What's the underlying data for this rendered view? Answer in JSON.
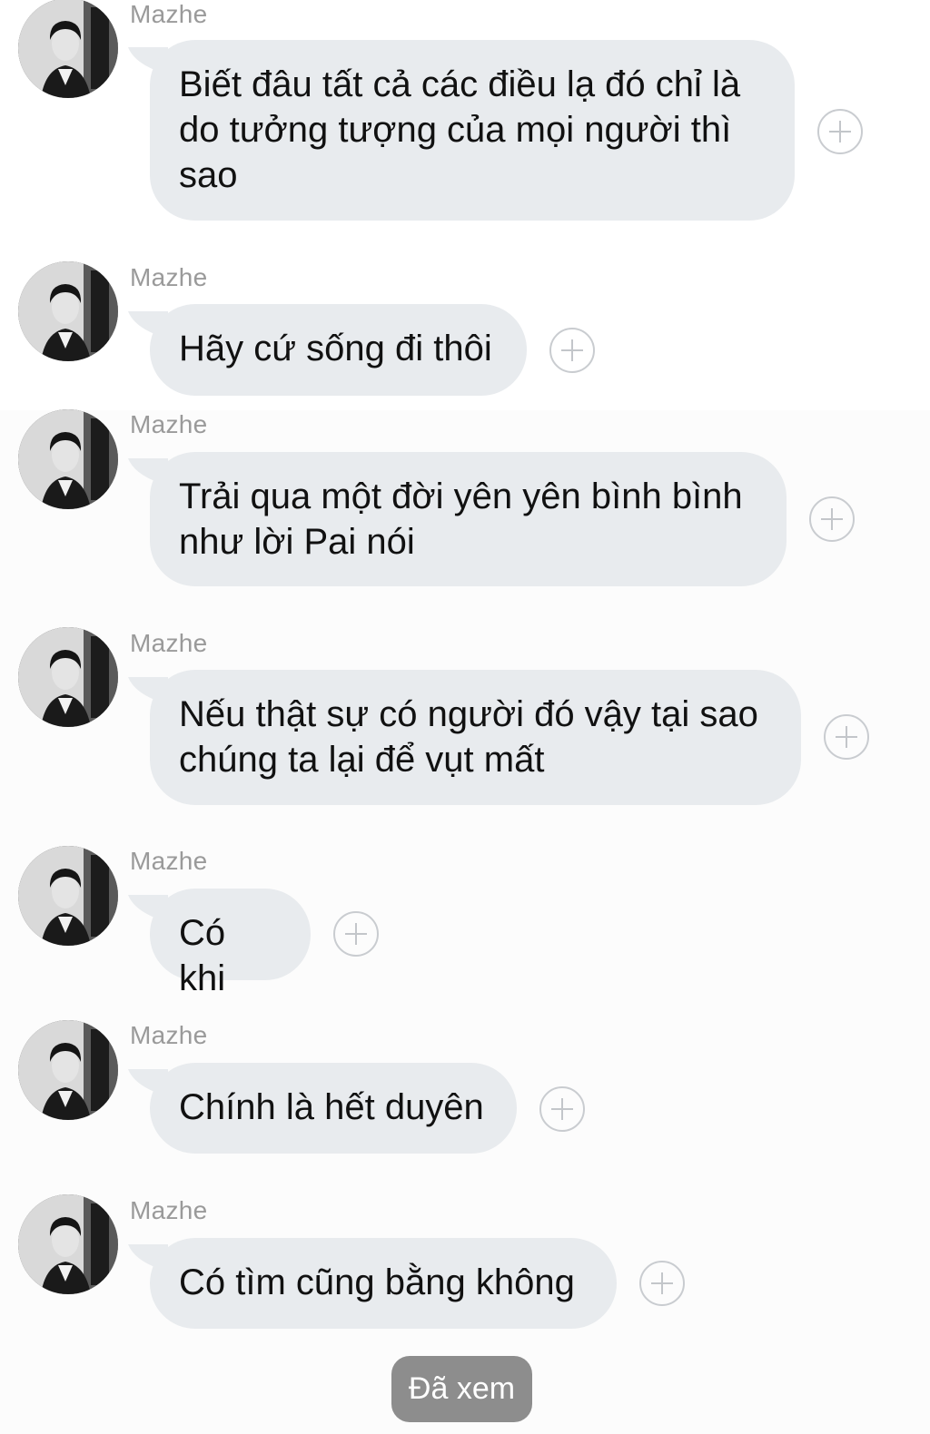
{
  "messages": [
    {
      "sender": "Mazhe",
      "text": "Biết đâu tất cả các điều lạ đó chỉ là do tưởng tượng của mọi người thì sao"
    },
    {
      "sender": "Mazhe",
      "text": "Hãy cứ sống đi thôi"
    },
    {
      "sender": "Mazhe",
      "text": "Trải qua một đời yên yên bình bình như lời Pai nói"
    },
    {
      "sender": "Mazhe",
      "text": "Nếu thật sự có người đó vậy tại sao chúng ta lại để vụt mất"
    },
    {
      "sender": "Mazhe",
      "text": "Có khi"
    },
    {
      "sender": "Mazhe",
      "text": "Chính là hết duyên"
    },
    {
      "sender": "Mazhe",
      "text": "Có tìm cũng bằng không"
    }
  ],
  "status": {
    "seen_label": "Đã xem"
  },
  "icons": {
    "avatar": "user-avatar-photo",
    "react": "plus-circle-icon"
  },
  "colors": {
    "bubble": "#e8ebee",
    "sender": "#9a9a9a",
    "seen_badge": "#8d8d8d"
  }
}
